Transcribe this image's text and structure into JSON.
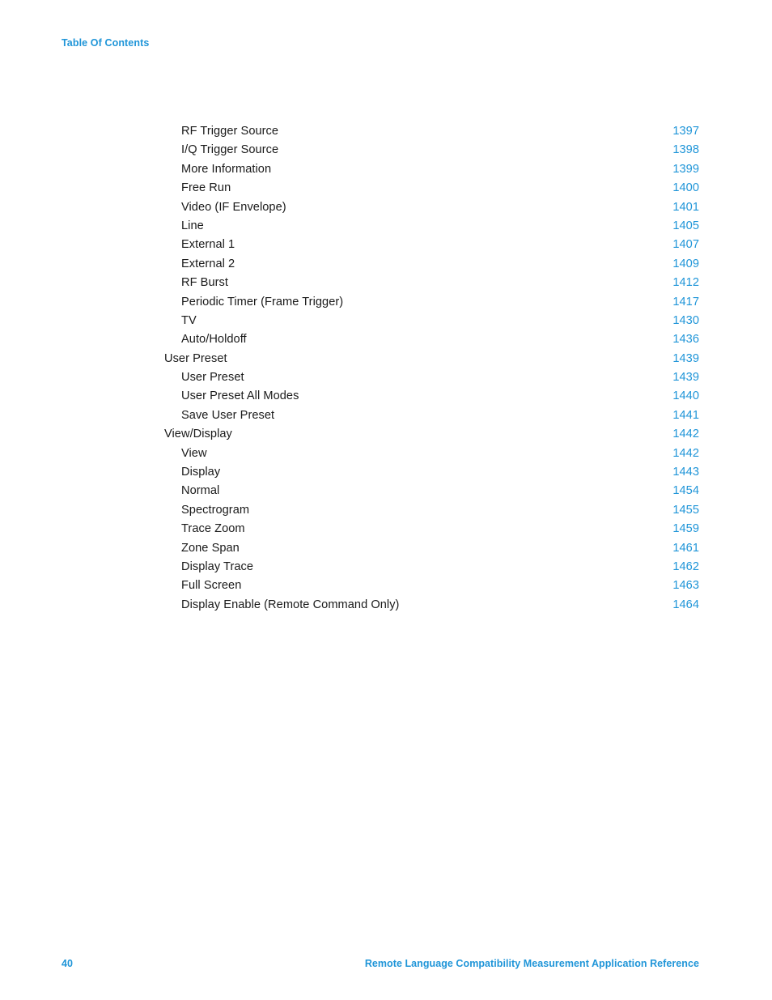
{
  "header": {
    "title": "Table Of Contents"
  },
  "colors": {
    "accent_blue": "#1f95d8",
    "body_text": "#1a1a1a",
    "page_background": "#ffffff"
  },
  "toc": {
    "entries": [
      {
        "label": "RF Trigger Source",
        "page": "1397",
        "level": 2
      },
      {
        "label": "I/Q Trigger Source",
        "page": "1398",
        "level": 2
      },
      {
        "label": "More Information",
        "page": "1399",
        "level": 2
      },
      {
        "label": "Free Run",
        "page": "1400",
        "level": 2
      },
      {
        "label": "Video (IF Envelope)",
        "page": "1401",
        "level": 2
      },
      {
        "label": "Line",
        "page": "1405",
        "level": 2
      },
      {
        "label": "External 1",
        "page": "1407",
        "level": 2
      },
      {
        "label": "External 2",
        "page": "1409",
        "level": 2
      },
      {
        "label": "RF Burst",
        "page": "1412",
        "level": 2
      },
      {
        "label": "Periodic Timer (Frame Trigger)",
        "page": "1417",
        "level": 2
      },
      {
        "label": "TV",
        "page": "1430",
        "level": 2
      },
      {
        "label": "Auto/Holdoff",
        "page": "1436",
        "level": 2
      },
      {
        "label": "User Preset",
        "page": "1439",
        "level": 1
      },
      {
        "label": "User Preset",
        "page": "1439",
        "level": 2
      },
      {
        "label": "User Preset All Modes",
        "page": "1440",
        "level": 2
      },
      {
        "label": "Save User Preset",
        "page": "1441",
        "level": 2
      },
      {
        "label": "View/Display",
        "page": "1442",
        "level": 1
      },
      {
        "label": "View",
        "page": "1442",
        "level": 2
      },
      {
        "label": "Display",
        "page": "1443",
        "level": 2
      },
      {
        "label": "Normal",
        "page": "1454",
        "level": 2
      },
      {
        "label": "Spectrogram",
        "page": "1455",
        "level": 2
      },
      {
        "label": "Trace Zoom",
        "page": "1459",
        "level": 2
      },
      {
        "label": "Zone Span",
        "page": "1461",
        "level": 2
      },
      {
        "label": "Display Trace",
        "page": "1462",
        "level": 2
      },
      {
        "label": "Full Screen",
        "page": "1463",
        "level": 2
      },
      {
        "label": "Display Enable (Remote Command Only)",
        "page": "1464",
        "level": 2
      }
    ]
  },
  "footer": {
    "folio": "40",
    "document_title": "Remote Language Compatibility Measurement Application Reference"
  }
}
